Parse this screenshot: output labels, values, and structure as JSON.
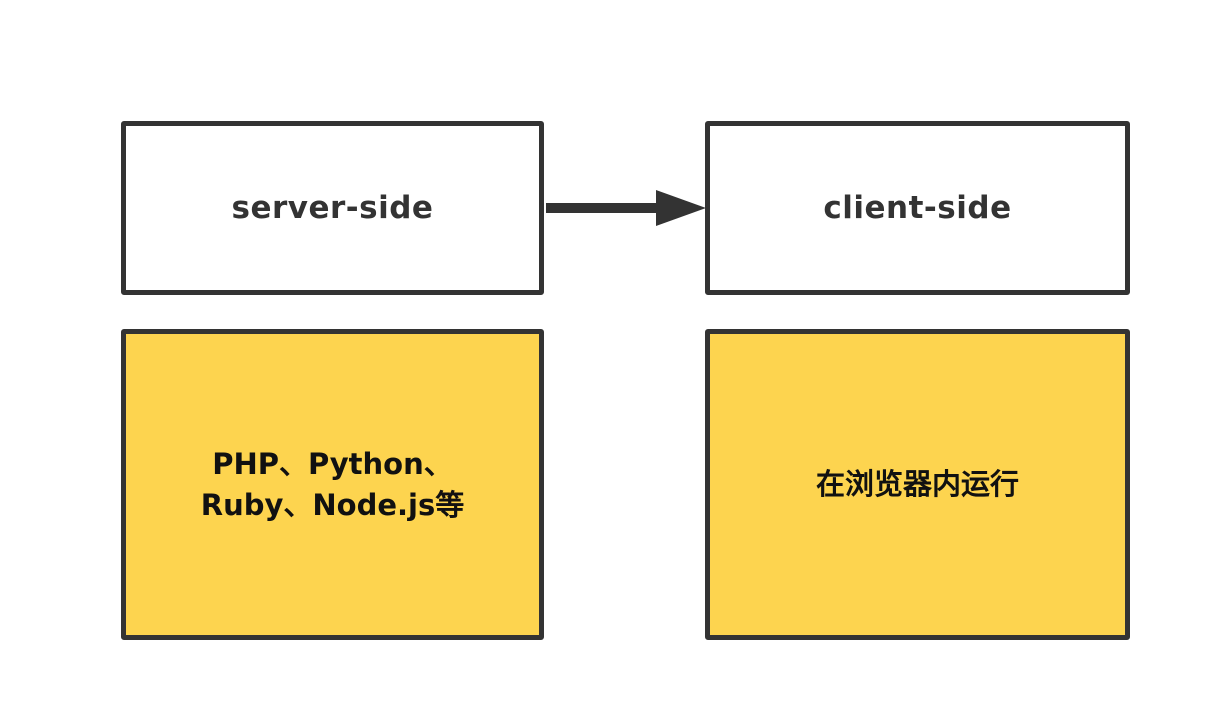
{
  "diagram": {
    "server": {
      "label": "server-side",
      "description": "PHP、Python、\nRuby、Node.js等"
    },
    "client": {
      "label": "client-side",
      "description": "在浏览器内运行"
    },
    "colors": {
      "border": "#333333",
      "description_fill": "#fdd44f",
      "label_fill": "#ffffff"
    }
  }
}
